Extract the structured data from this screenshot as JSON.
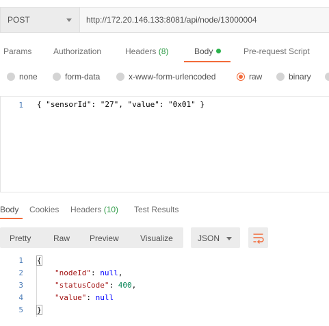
{
  "request": {
    "method": "POST",
    "url": "http://172.20.146.133:8081/api/node/13000004"
  },
  "request_tabs": [
    {
      "label": "Params"
    },
    {
      "label": "Authorization"
    },
    {
      "label": "Headers",
      "count": "(8)"
    },
    {
      "label": "Body"
    },
    {
      "label": "Pre-request Script"
    }
  ],
  "body_types": [
    {
      "label": "none",
      "checked": false
    },
    {
      "label": "form-data",
      "checked": false
    },
    {
      "label": "x-www-form-urlencoded",
      "checked": false
    },
    {
      "label": "raw",
      "checked": true
    },
    {
      "label": "binary",
      "checked": false
    }
  ],
  "request_body": {
    "line_numbers": [
      "1"
    ],
    "lines": [
      "{ \"sensorId\": \"27\", \"value\": \"0x01\" }"
    ]
  },
  "response_tabs": [
    {
      "label": "Body"
    },
    {
      "label": "Cookies"
    },
    {
      "label": "Headers",
      "count": "(10)"
    },
    {
      "label": "Test Results"
    }
  ],
  "response_views": [
    "Pretty",
    "Raw",
    "Preview",
    "Visualize"
  ],
  "response_format": "JSON",
  "response_body": {
    "line_numbers": [
      "1",
      "2",
      "3",
      "4",
      "5"
    ],
    "node_id_key": "\"nodeId\"",
    "node_id_value": "null",
    "status_code_key": "\"statusCode\"",
    "status_code_value": "400",
    "value_key": "\"value\"",
    "value_value": "null"
  },
  "colors": {
    "accent": "#f26b3a",
    "count_green": "#2e9b46",
    "line_number_blue": "#4a7bb7"
  }
}
